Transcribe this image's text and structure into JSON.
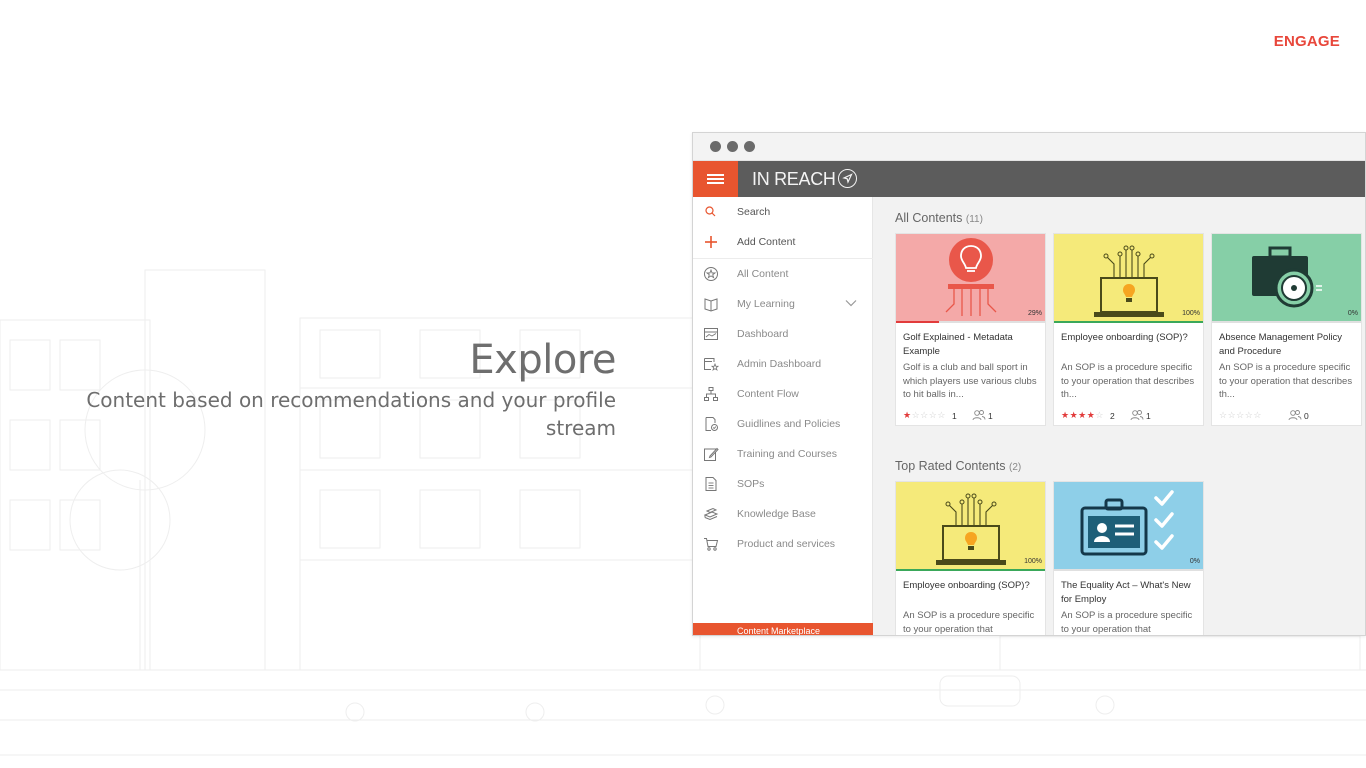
{
  "header": {
    "engage_label": "ENGAGE"
  },
  "hero": {
    "title": "Explore",
    "subtitle_line1": "Content based on recommendations and your profile",
    "subtitle_line2": "stream"
  },
  "app": {
    "brand": "IN REACH",
    "accent_color": "#e8552f",
    "sidebar": {
      "items": [
        {
          "label": "Search",
          "icon": "search-icon"
        },
        {
          "label": "Add Content",
          "icon": "plus-icon"
        },
        {
          "label": "All Content",
          "icon": "star-circle-icon"
        },
        {
          "label": "My Learning",
          "icon": "book-icon"
        },
        {
          "label": "Dashboard",
          "icon": "dashboard-icon"
        },
        {
          "label": "Admin Dashboard",
          "icon": "admin-dashboard-icon"
        },
        {
          "label": "Content Flow",
          "icon": "flow-icon"
        },
        {
          "label": "Guidlines and Policies",
          "icon": "policy-icon"
        },
        {
          "label": "Training and Courses",
          "icon": "edit-icon"
        },
        {
          "label": "SOPs",
          "icon": "document-icon"
        },
        {
          "label": "Knowledge Base",
          "icon": "books-stack-icon"
        },
        {
          "label": "Product and services",
          "icon": "cart-icon"
        }
      ],
      "bottom_label": "Content Marketplace"
    },
    "all_contents": {
      "title": "All Contents",
      "count": "(11)",
      "cards": [
        {
          "title": "Golf Explained - Metadata Example",
          "description": "Golf is a club and ball sport in which players use various clubs to hit balls in...",
          "percent": "29%",
          "progress": 0.29,
          "rating": 1,
          "rating_count": "1",
          "users": "1",
          "thumb_color": "#f4a9a8"
        },
        {
          "title": "Employee onboarding (SOP)?",
          "description": " An SOP is a procedure specific to your operation that describes th...",
          "percent": "100%",
          "progress": 1.0,
          "rating": 4,
          "rating_count": "2",
          "users": "1",
          "thumb_color": "#f5ea7a"
        },
        {
          "title": "Absence Management Policy and Procedure",
          "description": " An SOP is a procedure specific to your operation that describes th...",
          "percent": "0%",
          "progress": 0,
          "rating": 0,
          "rating_count": "",
          "users": "0",
          "thumb_color": "#86cfa7"
        }
      ]
    },
    "top_rated": {
      "title": "Top Rated Contents",
      "count": "(2)",
      "cards": [
        {
          "title": "Employee onboarding (SOP)?",
          "description": " An SOP is a procedure specific to your operation that",
          "percent": "100%",
          "progress": 1.0,
          "thumb_color": "#f5ea7a"
        },
        {
          "title": "The Equality Act – What's New for Employ",
          "description": " An SOP is a procedure specific to your operation that",
          "percent": "0%",
          "progress": 0,
          "thumb_color": "#8ecfe8"
        }
      ]
    }
  }
}
